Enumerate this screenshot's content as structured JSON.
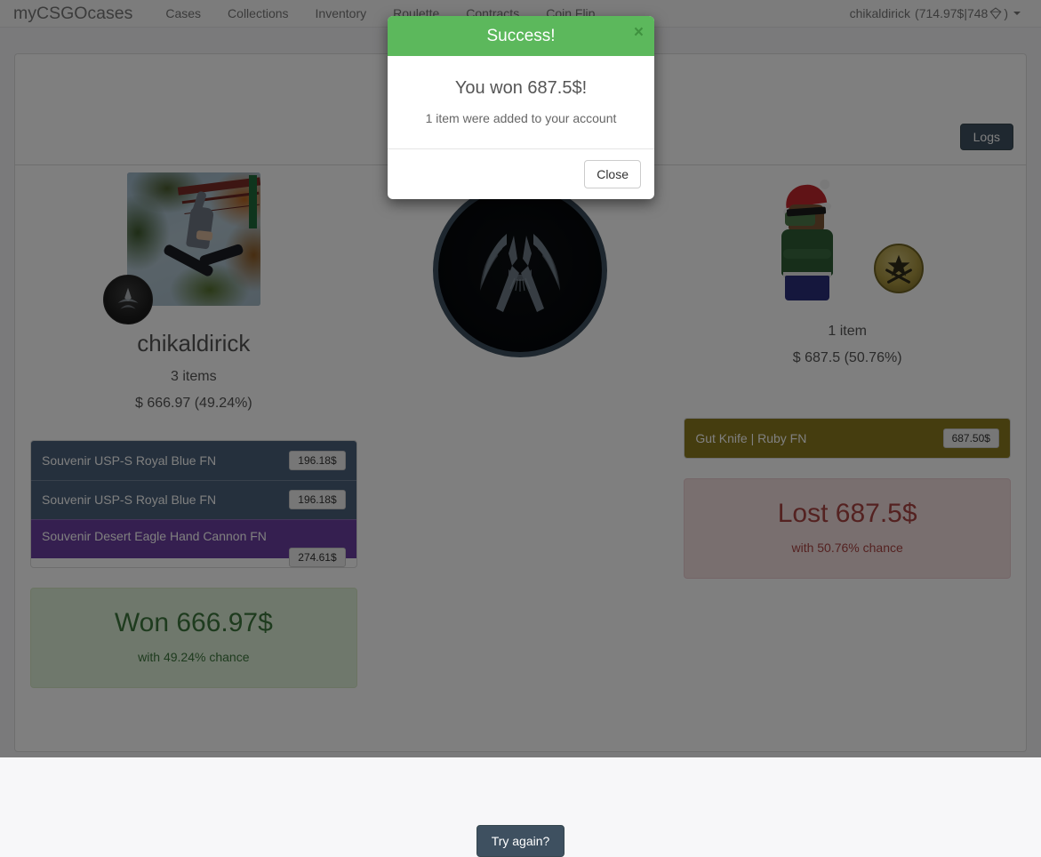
{
  "navbar": {
    "brand": "myCSGOcases",
    "links": [
      "Cases",
      "Collections",
      "Inventory",
      "Roulette",
      "Contracts",
      "Coin Flip"
    ],
    "account": {
      "name": "chikaldirick",
      "open_paren": "(",
      "balance": "714.97$",
      "separator": " | ",
      "gems": "748",
      "gem_icon": "gem-icon",
      "close_paren": ")"
    }
  },
  "panel": {
    "logs_label": "Logs"
  },
  "players": {
    "left": {
      "name": "chikaldirick",
      "items_count": "3 items",
      "value": "$ 666.97 (49.24%)",
      "avatar_icon": "user-avatar-photo",
      "rank_icon": "rank-badge-icon",
      "items": [
        {
          "name": "Souvenir USP-S Royal Blue FN",
          "price": "196.18$",
          "rarity_color": "#4a617a"
        },
        {
          "name": "Souvenir USP-S Royal Blue FN",
          "price": "196.18$",
          "rarity_color": "#4a617a"
        },
        {
          "name": "Souvenir Desert Eagle Hand Cannon FN",
          "price": "274.61$",
          "rarity_color": "#6b3fa0"
        }
      ],
      "result": {
        "type": "win",
        "title": "Won 666.97$",
        "subtitle": "with 49.24% chance"
      }
    },
    "right": {
      "items_count": "1 item",
      "value": "$ 687.5 (50.76%)",
      "avatar_icon": "santa-hat-character-icon",
      "rank_icon": "terrorist-badge-icon",
      "items": [
        {
          "name": "Gut Knife | Ruby FN",
          "price": "687.50$",
          "rarity_color": "#8a7a1e"
        }
      ],
      "result": {
        "type": "lose",
        "title": "Lost 687.5$",
        "subtitle": "with 50.76% chance"
      }
    }
  },
  "center": {
    "logo_icon": "counter-terrorist-logo-icon",
    "try_again_label": "Try again?"
  },
  "modal": {
    "title": "Success!",
    "close_x": "×",
    "message": "You won 687.5$!",
    "submessage": "1 item were added to your account",
    "close_label": "Close"
  },
  "colors": {
    "success_green": "#5cb85c",
    "win_bg": "#dff0d8",
    "lose_bg": "#f2dede",
    "button_dark": "#3e5060"
  }
}
